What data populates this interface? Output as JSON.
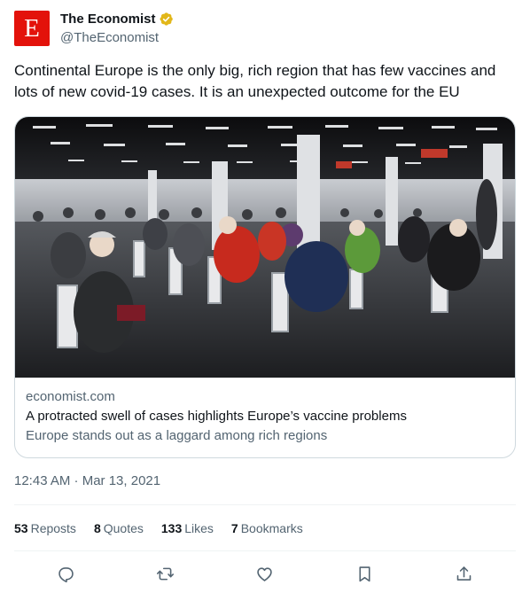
{
  "author": {
    "logo_letter": "E",
    "display_name": "The Economist",
    "handle": "@TheEconomist"
  },
  "tweet": {
    "text": "Continental Europe is the only big, rich region that has few vaccines and lots of new covid-19 cases. It is an unexpected outcome for the EU"
  },
  "link_card": {
    "domain": "economist.com",
    "title": "A protracted swell of cases highlights Europe’s vaccine problems",
    "description": "Europe stands out as a laggard among rich regions"
  },
  "timestamp": "12:43 AM · Mar 13, 2021",
  "stats": {
    "reposts_count": "53",
    "reposts_label": "Reposts",
    "quotes_count": "8",
    "quotes_label": "Quotes",
    "likes_count": "133",
    "likes_label": "Likes",
    "bookmarks_count": "7",
    "bookmarks_label": "Bookmarks"
  },
  "colors": {
    "brand_red": "#e3120b",
    "verified_gold": "#e2b719",
    "secondary_text": "#536471",
    "border": "#cfd9de"
  },
  "icons": [
    "verified-badge-icon",
    "reply-icon",
    "repost-icon",
    "like-icon",
    "bookmark-icon",
    "share-icon"
  ]
}
